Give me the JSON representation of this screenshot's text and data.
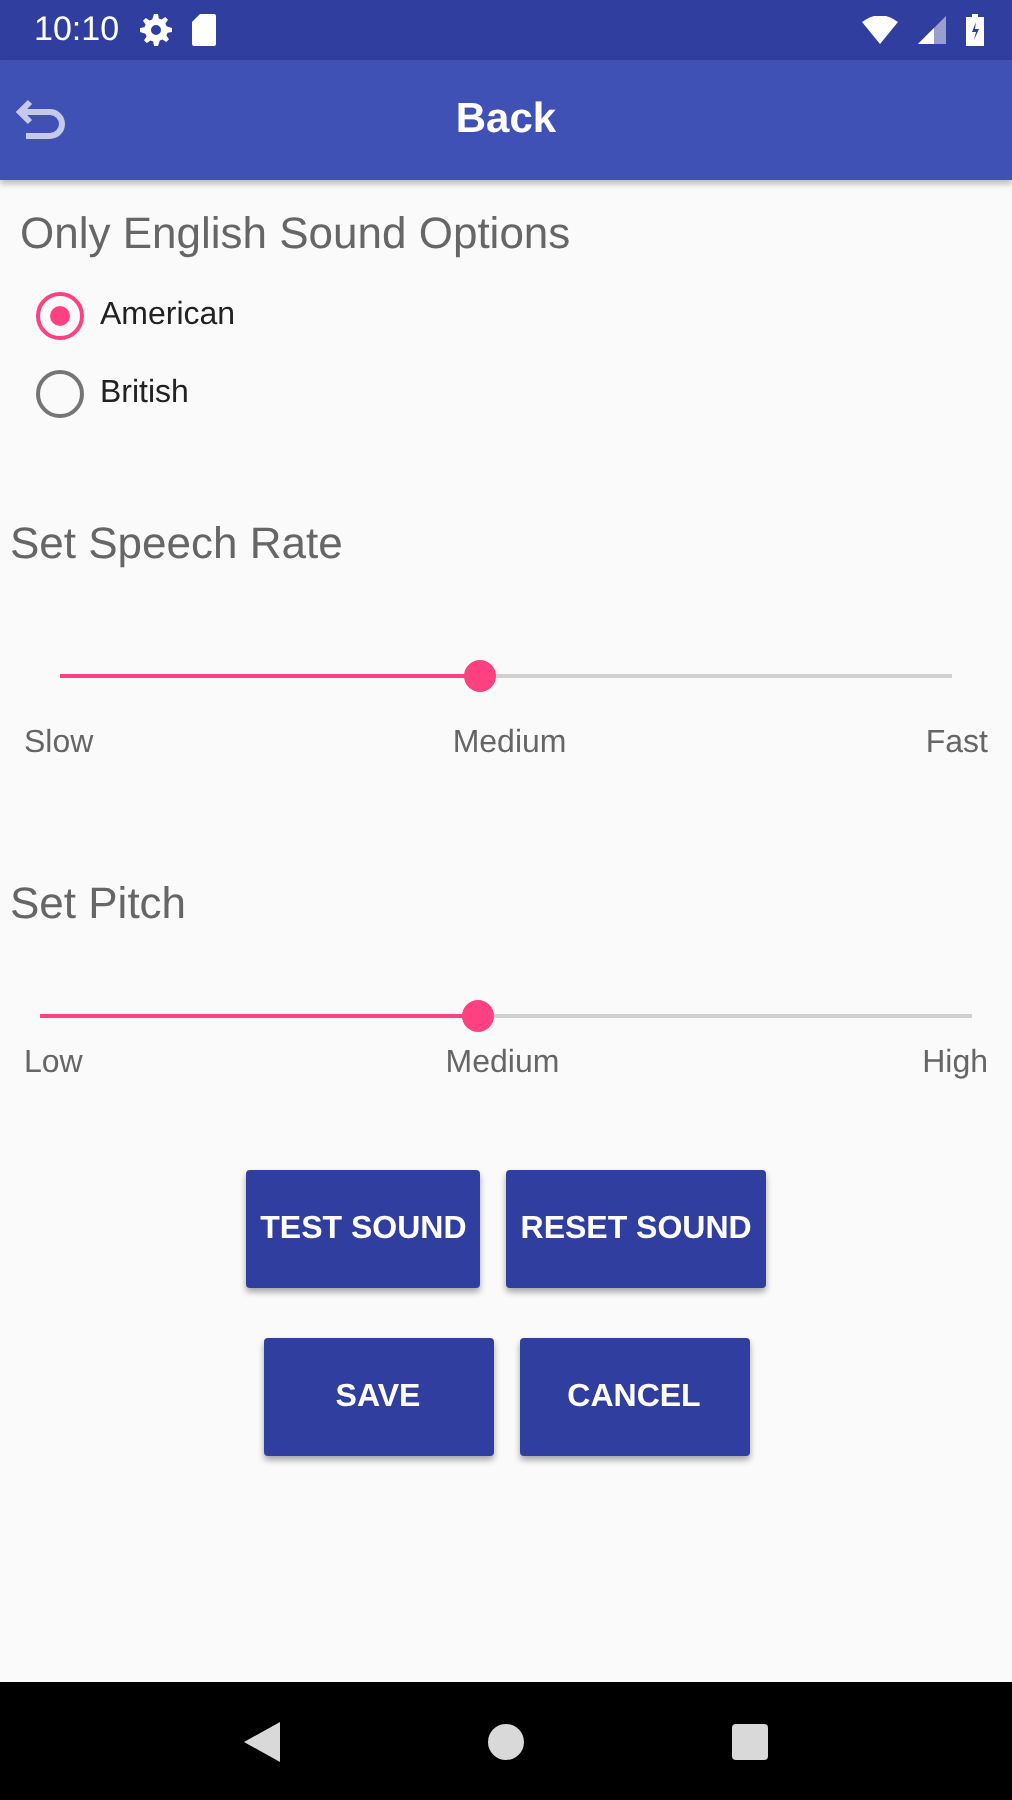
{
  "status_bar": {
    "time": "10:10"
  },
  "app_bar": {
    "title": "Back"
  },
  "language": {
    "title": "Only English Sound Options",
    "options": [
      {
        "label": "American",
        "selected": true
      },
      {
        "label": "British",
        "selected": false
      }
    ]
  },
  "sliders": [
    {
      "title": "Set Speech Rate",
      "level": 0.47,
      "labels": [
        "Slow",
        "Medium",
        "Fast"
      ]
    },
    {
      "title": "Set Pitch",
      "level": 0.47,
      "labels": [
        "Low",
        "Medium",
        "High"
      ]
    }
  ],
  "buttons": [
    [
      "TEST SOUND",
      "RESET SOUND"
    ],
    [
      "SAVE",
      "CANCEL"
    ]
  ]
}
